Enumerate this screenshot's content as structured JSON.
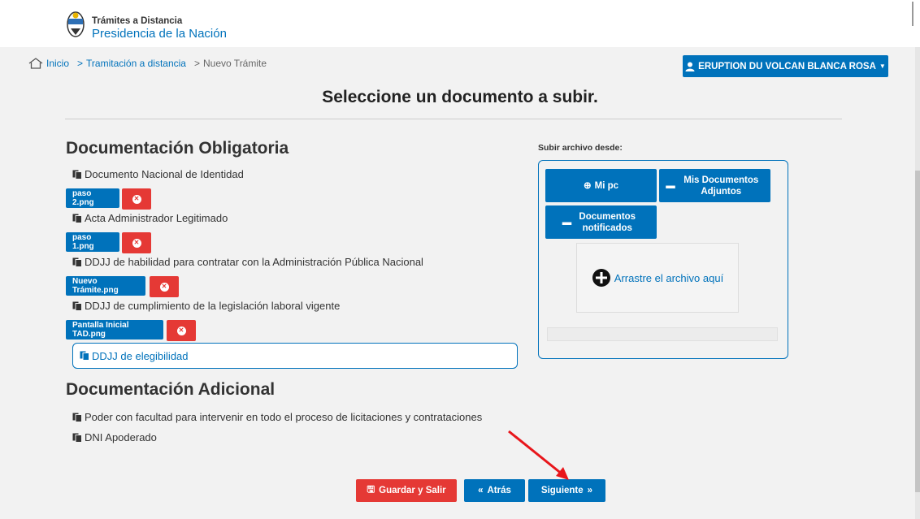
{
  "header": {
    "brand_top": "Trámites a Distancia",
    "brand_main": "Presidencia de la Nación"
  },
  "breadcrumb": {
    "home": "Inicio",
    "level1": "Tramitación a distancia",
    "level2": "Nuevo Trámite"
  },
  "user_menu": {
    "label": "ERUPTION DU VOLCAN BLANCA ROSA"
  },
  "page_title": "Seleccione un documento a subir.",
  "obligatoria": {
    "title": "Documentación Obligatoria",
    "items": [
      {
        "label": "Documento Nacional de Identidad",
        "file": "paso 2.png"
      },
      {
        "label": "Acta Administrador Legitimado",
        "file": "paso 1.png"
      },
      {
        "label": "DDJJ de habilidad para contratar con la Administración Pública Nacional",
        "file": "Nuevo Trámite.png"
      },
      {
        "label": "DDJJ de cumplimiento de la legislación laboral vigente",
        "file": "Pantalla Inicial TAD.png"
      }
    ],
    "selected": "DDJJ de elegibilidad"
  },
  "adicional": {
    "title": "Documentación Adicional",
    "items": [
      {
        "label": "Poder con facultad para intervenir en todo el proceso de licitaciones y contrataciones"
      },
      {
        "label": "DNI Apoderado"
      }
    ]
  },
  "upload": {
    "label": "Subir archivo desde:",
    "mi_pc": "Mi pc",
    "mis_docs": "Mis Documentos Adjuntos",
    "notificados": "Documentos notificados",
    "dropzone": "Arrastre el archivo aquí"
  },
  "actions": {
    "save": "Guardar y Salir",
    "back": "Atrás",
    "next": "Siguiente"
  },
  "colors": {
    "primary": "#0072bb",
    "danger": "#e53935",
    "annotation": "#e8161b"
  }
}
